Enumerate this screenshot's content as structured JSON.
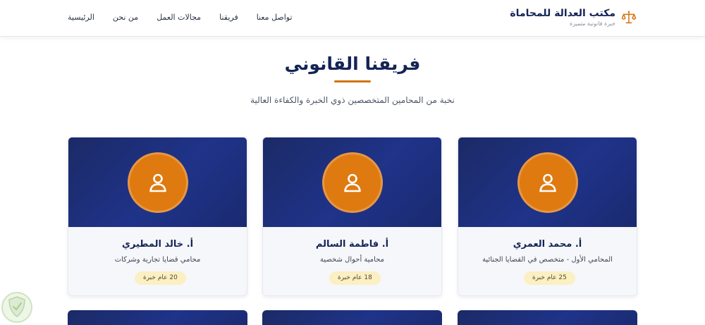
{
  "header": {
    "brand_title": "مكتب العدالة للمحاماة",
    "brand_subtitle": "خبرة قانونية متميزة",
    "brand_icon": "scales-icon",
    "nav": [
      "الرئيسية",
      "من نحن",
      "مجالات العمل",
      "فريقنا",
      "تواصل معنا"
    ]
  },
  "section": {
    "title": "فريقنا القانوني",
    "subtitle": "نخبة من المحامين المتخصصين ذوي الخبرة والكفاءة العالية"
  },
  "team": [
    {
      "name": "أ. محمد العمري",
      "role": "المحامي الأول - متخصص في القضايا الجنائية",
      "experience": "25 عام خبرة"
    },
    {
      "name": "أ. فاطمة السالم",
      "role": "محامية أحوال شخصية",
      "experience": "18 عام خبرة"
    },
    {
      "name": "أ. خالد المطيري",
      "role": "محامي قضايا تجارية وشركات",
      "experience": "20 عام خبرة"
    }
  ],
  "colors": {
    "navy": "#152456",
    "card_gradient": "#1f3389",
    "accent_orange": "#df7a10",
    "badge_bg": "#fbefc4"
  }
}
